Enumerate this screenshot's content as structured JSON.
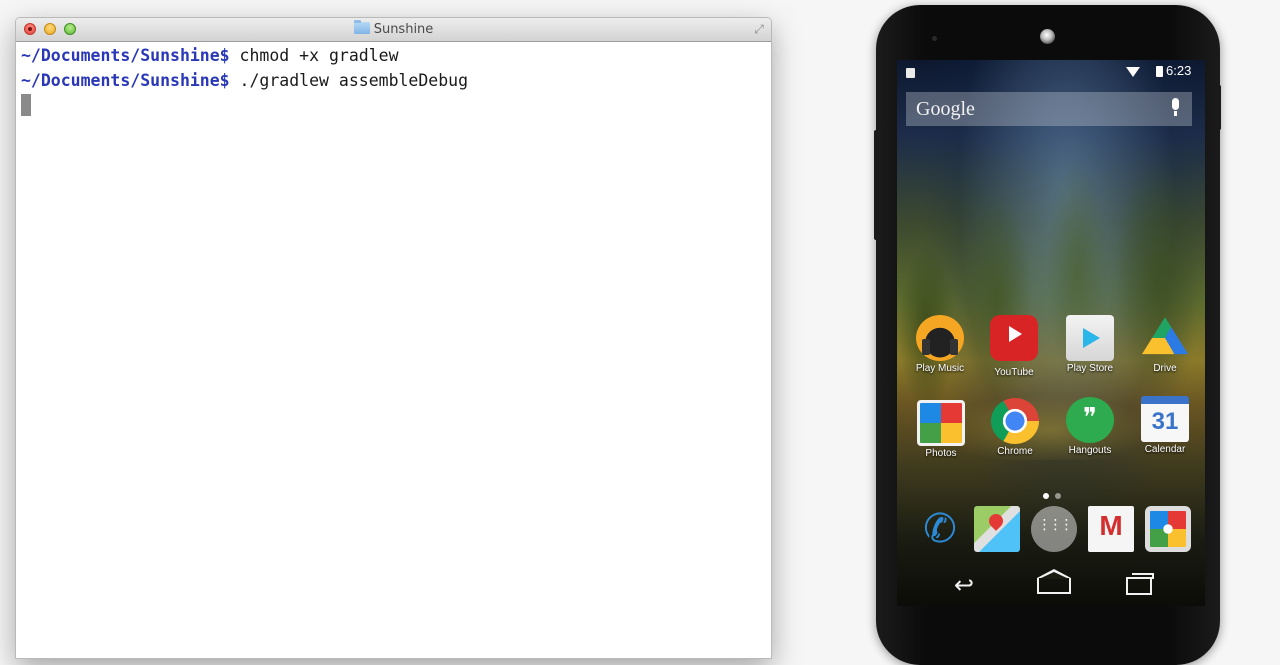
{
  "terminal": {
    "title": "Sunshine",
    "lines": [
      {
        "prompt": "~/Documents/Sunshine$",
        "command": " chmod +x gradlew"
      },
      {
        "prompt": "~/Documents/Sunshine$",
        "command": " ./gradlew assembleDebug"
      }
    ],
    "icons": {
      "titlebar_folder": "folder-icon",
      "fullscreen": "fullscreen-arrows-icon"
    }
  },
  "phone": {
    "status": {
      "time": "6:23",
      "icons": [
        "notification-icon",
        "wifi-icon",
        "battery-icon"
      ]
    },
    "search": {
      "label": "Google",
      "icon": "mic-icon"
    },
    "apps": [
      {
        "label": "Play Music",
        "icon": "play-music-icon"
      },
      {
        "label": "YouTube",
        "icon": "youtube-icon"
      },
      {
        "label": "Play Store",
        "icon": "play-store-icon"
      },
      {
        "label": "Drive",
        "icon": "drive-icon"
      },
      {
        "label": "Photos",
        "icon": "photos-icon"
      },
      {
        "label": "Chrome",
        "icon": "chrome-icon"
      },
      {
        "label": "Hangouts",
        "icon": "hangouts-icon"
      },
      {
        "label": "Calendar",
        "icon": "calendar-icon",
        "glyph": "31"
      }
    ],
    "dock": [
      "phone-icon",
      "maps-icon",
      "app-launcher-icon",
      "gmail-icon",
      "camera-icon"
    ],
    "nav": [
      "back-icon",
      "home-icon",
      "recents-icon"
    ],
    "colors": {
      "terminal_prompt": "#2a38b8",
      "youtube": "#d82424",
      "hangouts": "#2dab4e"
    }
  }
}
